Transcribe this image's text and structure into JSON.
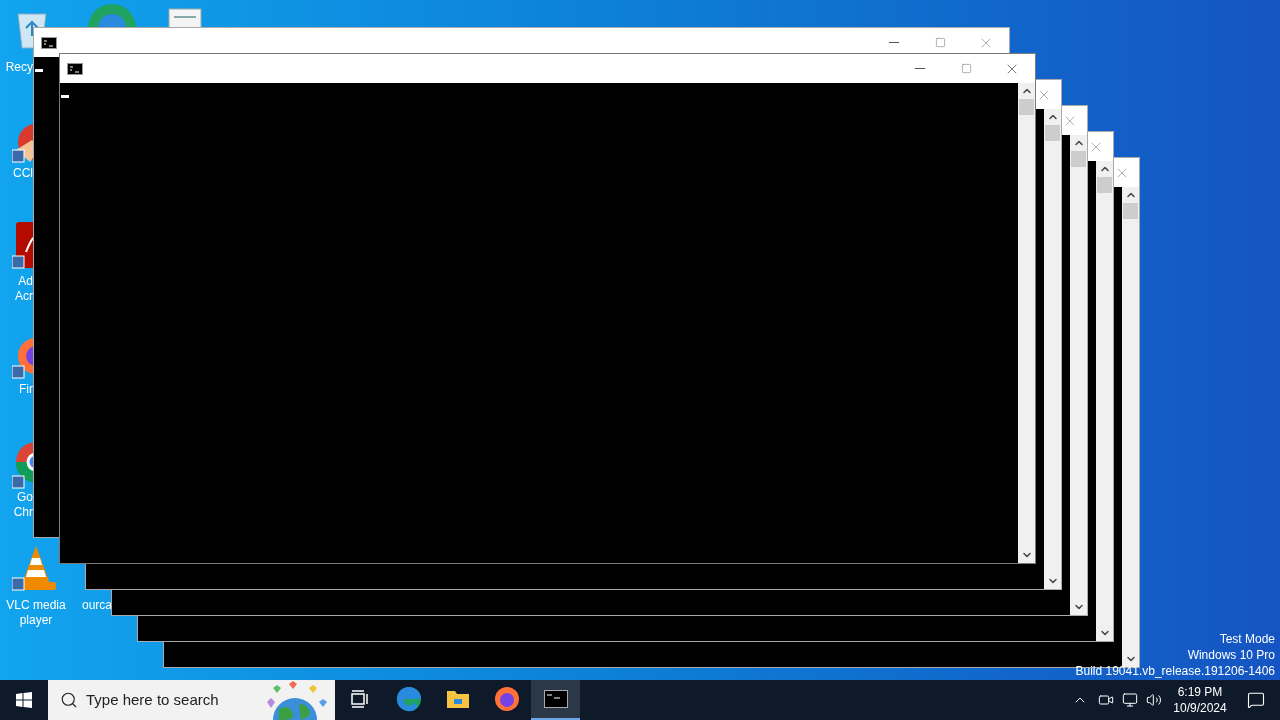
{
  "desktop_icons": [
    {
      "kind": "recycle-bin",
      "lines": [
        "Recy"
      ]
    },
    {
      "kind": "edge"
    },
    {
      "kind": "document"
    },
    {
      "kind": "cleaner",
      "lines": [
        "CCl"
      ]
    },
    {
      "kind": "acrobat",
      "lines": [
        "Ad",
        "Acr"
      ]
    },
    {
      "kind": "firefox",
      "lines": [
        "Fir"
      ]
    },
    {
      "kind": "chrome",
      "lines": [
        "Go",
        "Chr"
      ]
    },
    {
      "kind": "vlc",
      "lines": [
        "VLC media",
        "player"
      ]
    },
    {
      "kind": "hidden",
      "lines": [
        "ourca"
      ]
    }
  ],
  "windows": [
    {
      "selected": false
    },
    {
      "selected": true
    },
    {
      "selected": false
    },
    {
      "selected": false
    },
    {
      "selected": false
    },
    {
      "selected": false
    }
  ],
  "watermark_text": [
    "Test Mode",
    "Windows 10 Pro",
    "Build 19041.vb_release.191206-1406"
  ],
  "taskbar": {
    "search": {
      "placeholder": "Type here to search"
    },
    "apps": [
      {
        "kind": "task-view",
        "selected": false
      },
      {
        "kind": "edge",
        "selected": false
      },
      {
        "kind": "explorer",
        "selected": false
      },
      {
        "kind": "firefox",
        "selected": false
      },
      {
        "kind": "cmd",
        "selected": true
      }
    ],
    "clock": {
      "time": "6:19 PM",
      "date": "10/9/2024"
    }
  }
}
